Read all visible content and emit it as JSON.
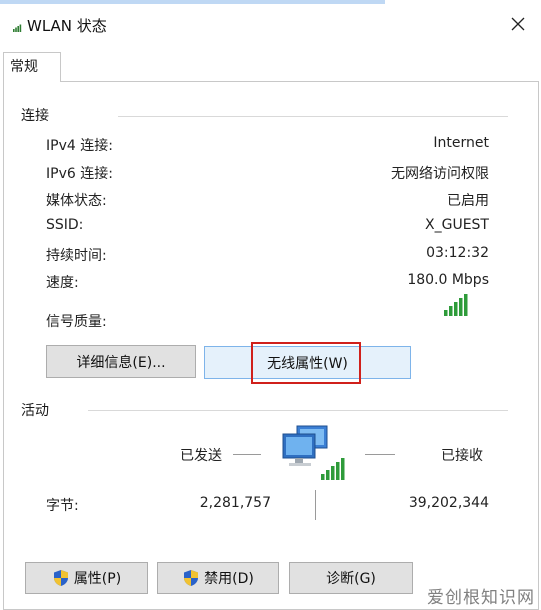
{
  "window": {
    "title": "WLAN 状态",
    "close_label": "close"
  },
  "tabs": [
    {
      "label": "常规"
    }
  ],
  "connection": {
    "section_title": "连接",
    "rows": [
      {
        "label": "IPv4 连接:",
        "value": "Internet"
      },
      {
        "label": "IPv6 连接:",
        "value": "无网络访问权限"
      },
      {
        "label": "媒体状态:",
        "value": "已启用"
      },
      {
        "label": "SSID:",
        "value": "X_GUEST"
      },
      {
        "label": "持续时间:",
        "value": "03:12:32"
      },
      {
        "label": "速度:",
        "value": "180.0 Mbps"
      }
    ],
    "signal_label": "信号质量:",
    "signal_bars": 5,
    "details_button": "详细信息(E)...",
    "wireless_props_button": "无线属性(W)"
  },
  "activity": {
    "section_title": "活动",
    "sent_label": "已发送",
    "received_label": "已接收",
    "bytes_label": "字节:",
    "bytes_sent": "2,281,757",
    "bytes_received": "39,202,344"
  },
  "footer": {
    "properties_button": "属性(P)",
    "disable_button": "禁用(D)",
    "diagnose_button": "诊断(G)"
  },
  "watermark": "爱创根知识网",
  "colors": {
    "accent_red": "#d0201b",
    "signal_green": "#2e9b3a",
    "focus_blue": "#7eb4ea"
  }
}
